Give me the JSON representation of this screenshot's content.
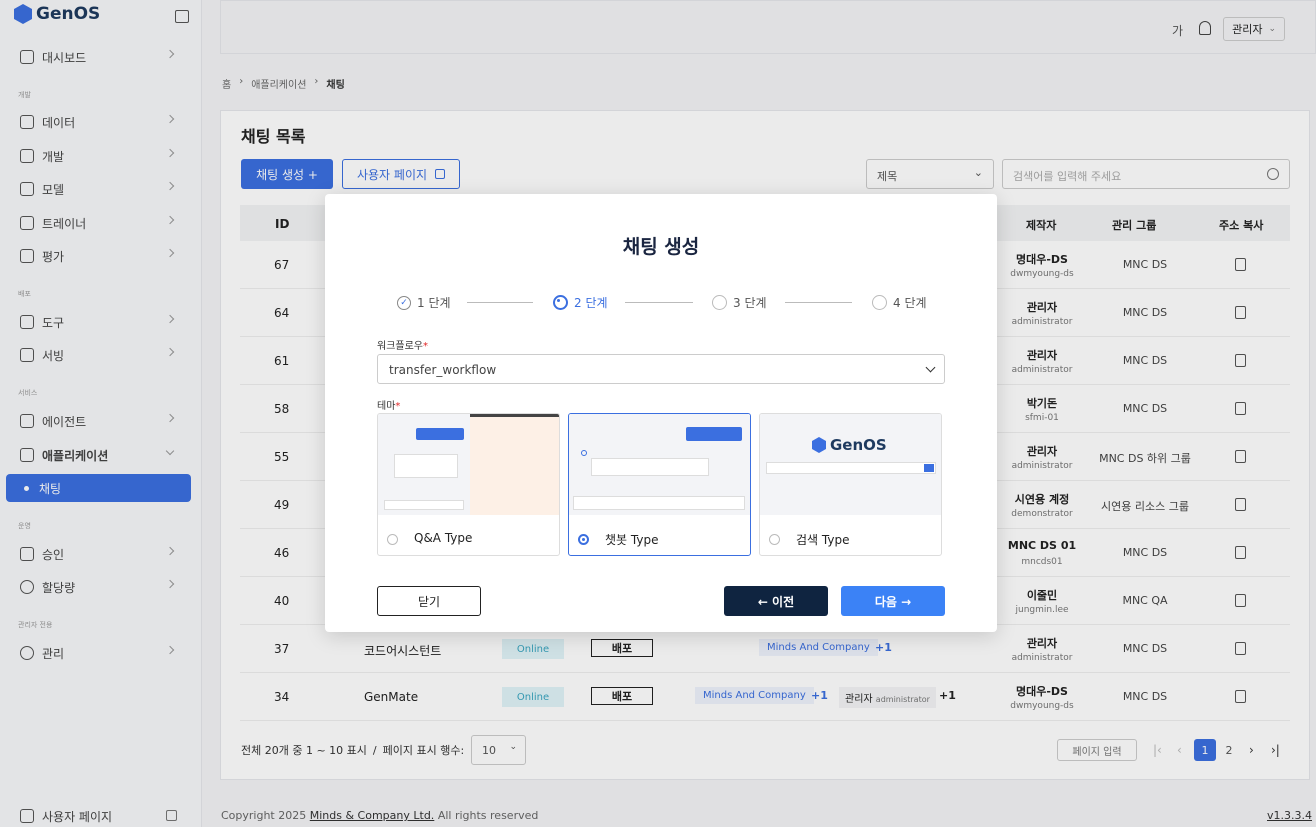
{
  "app": {
    "logo_text": "GenOS",
    "version": "v1.3.3.4"
  },
  "sidebar": {
    "items": [
      {
        "label": "대시보드",
        "icon": "dashboard-icon"
      },
      {
        "label": "데이터",
        "icon": "database-icon"
      },
      {
        "label": "개발",
        "icon": "code-icon"
      },
      {
        "label": "모델",
        "icon": "cube-icon"
      },
      {
        "label": "트레이너",
        "icon": "pen-icon"
      },
      {
        "label": "평가",
        "icon": "chart-icon"
      },
      {
        "label": "도구",
        "icon": "tools-icon"
      },
      {
        "label": "서빙",
        "icon": "cloud-icon"
      },
      {
        "label": "에이전트",
        "icon": "calendar-icon"
      },
      {
        "label": "애플리케이션",
        "icon": "apps-icon"
      },
      {
        "label": "채팅",
        "icon": "dot-icon"
      },
      {
        "label": "승인",
        "icon": "check-icon"
      },
      {
        "label": "할당량",
        "icon": "clock-icon"
      },
      {
        "label": "관리",
        "icon": "gear-icon"
      }
    ],
    "sections": [
      "개발",
      "배포",
      "서비스",
      "운영",
      "관리자 전용"
    ],
    "footer_label": "사용자 페이지"
  },
  "header": {
    "lang_label": "가",
    "user_label": "관리자"
  },
  "breadcrumb": {
    "home": "홈",
    "parent": "애플리케이션",
    "current": "채팅"
  },
  "page": {
    "title": "채팅 목록",
    "create_button": "채팅 생성 +",
    "user_page_button": "사용자 페이지",
    "filter_select": "제목",
    "search_placeholder": "검색어를 입력해 주세요"
  },
  "table": {
    "headers": {
      "id": "ID",
      "author": "제작자",
      "group": "관리 그룹",
      "copy": "주소 복사"
    },
    "rows": [
      {
        "id": "67",
        "author": "명대우-DS",
        "author_id": "dwmyoung-ds",
        "group": "MNC DS"
      },
      {
        "id": "64",
        "author": "관리자",
        "author_id": "administrator",
        "group": "MNC DS"
      },
      {
        "id": "61",
        "author": "관리자",
        "author_id": "administrator",
        "group": "MNC DS"
      },
      {
        "id": "58",
        "author": "박기돈",
        "author_id": "sfmi-01",
        "group": "MNC DS"
      },
      {
        "id": "55",
        "author": "관리자",
        "author_id": "administrator",
        "group": "MNC DS 하위 그룹"
      },
      {
        "id": "49",
        "author": "시연용 계정",
        "author_id": "demonstrator",
        "group": "시연용 리소스 그룹"
      },
      {
        "id": "46",
        "author": "MNC DS 01",
        "author_id": "mncds01",
        "group": "MNC DS"
      },
      {
        "id": "40",
        "author": "이줄민",
        "author_id": "jungmin.lee",
        "group": "MNC QA"
      },
      {
        "id": "37",
        "name": "코드어시스턴트",
        "status": "Online",
        "deploy": "배포",
        "company": "Minds And Company",
        "company_more": "+1",
        "author": "관리자",
        "author_id": "administrator",
        "group": "MNC DS"
      },
      {
        "id": "34",
        "name": "GenMate",
        "status": "Online",
        "deploy": "배포",
        "company": "Minds And Company",
        "company_more": "+1",
        "admin_tag": "관리자",
        "admin_tag_id": "administrator",
        "admin_more": "+1",
        "author": "명대우-DS",
        "author_id": "dwmyoung-ds",
        "group": "MNC DS"
      }
    ]
  },
  "pagination": {
    "summary": "전체 20개 중 1 ~ 10 표시",
    "separator": "/",
    "rows_label": "페이지 표시 행수:",
    "rows_value": "10",
    "page_input": "페이지 입력",
    "pages": [
      "1",
      "2"
    ]
  },
  "footer": {
    "copyright_prefix": "Copyright 2025",
    "company": "Minds & Company Ltd.",
    "suffix": "All rights reserved"
  },
  "modal": {
    "title": "채팅 생성",
    "steps": [
      "1 단계",
      "2 단계",
      "3 단계",
      "4 단계"
    ],
    "current_step": 2,
    "workflow_label": "워크플로우",
    "workflow_value": "transfer_workflow",
    "theme_label": "테마",
    "required_mark": "*",
    "themes": [
      {
        "label": "Q&A Type",
        "selected": false
      },
      {
        "label": "챗봇 Type",
        "selected": true
      },
      {
        "label": "검색 Type",
        "selected": false
      }
    ],
    "search_preview_logo": "GenOS",
    "close_button": "닫기",
    "prev_button": "← 이전",
    "next_button": "다음 →"
  },
  "colors": {
    "accent": "#3b6fe0",
    "dark": "#0f2440",
    "online": "#e0f3f8"
  }
}
